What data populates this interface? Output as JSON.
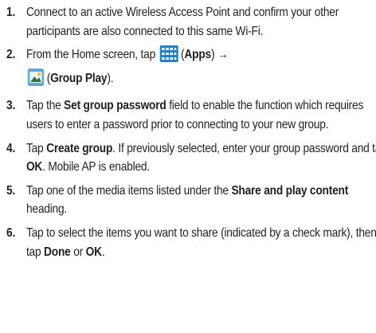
{
  "steps": [
    {
      "number": "1.",
      "text": "Connect to an active Wireless Access Point and confirm your other participants are also connected to this same Wi-Fi."
    },
    {
      "number": "2.",
      "before": "From the Home screen, tap",
      "apps_label": "Apps",
      "arrow": "→",
      "group_play_label": "Group Play",
      "icons": {
        "apps": "apps-grid-icon",
        "group_play": "group-play-icon"
      }
    },
    {
      "number": "3.",
      "before": "Tap the",
      "bold": "Set group password",
      "after": "field to enable the function which requires users to enter a password prior to connecting to your new group."
    },
    {
      "number": "4.",
      "before": "Tap",
      "bold1": "Create group",
      "middle": ". If previously selected, enter your group password and tap",
      "bold2": "OK",
      "after": ". Mobile AP is enabled."
    },
    {
      "number": "5.",
      "before": "Tap one of the media items listed under the",
      "bold": "Share and play content",
      "after": "heading."
    },
    {
      "number": "6.",
      "before": "Tap to select the items you want to share (indicated by a check mark), then tap",
      "bold1": "Done",
      "middle": "or",
      "bold2": "OK",
      "after": "."
    }
  ],
  "colors": {
    "text": "#231f20",
    "apps_icon": "#1f82c9",
    "group_play_icon": "#5aa9d8"
  }
}
